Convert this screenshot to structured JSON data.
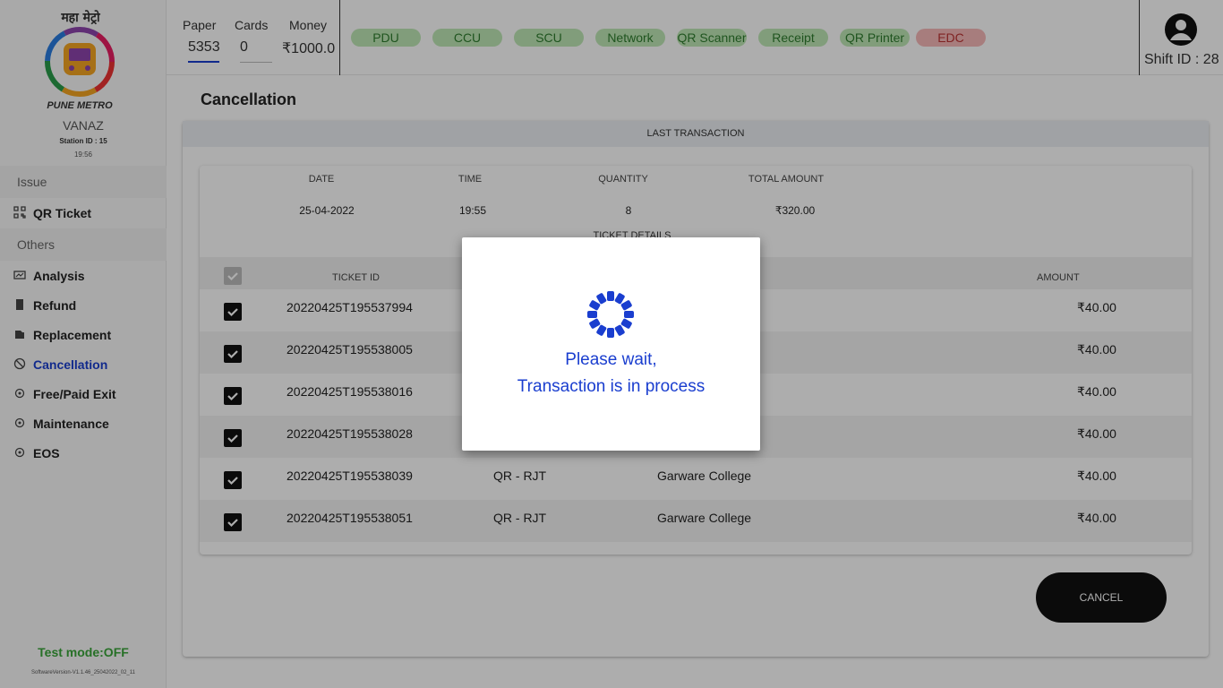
{
  "sidebar": {
    "logo_text_top": "महा मेट्रो",
    "logo_text_bottom": "PUNE METRO",
    "station_name": "VANAZ",
    "station_id": "Station ID : 15",
    "time": "19:56",
    "issue_label": "Issue",
    "others_label": "Others",
    "items": [
      {
        "label": "QR Ticket",
        "icon": "qr-icon"
      },
      {
        "label": "Analysis",
        "icon": "chart-icon"
      },
      {
        "label": "Refund",
        "icon": "refund-icon"
      },
      {
        "label": "Replacement",
        "icon": "replace-icon"
      },
      {
        "label": "Cancellation",
        "icon": "cancel-icon"
      },
      {
        "label": "Free/Paid Exit",
        "icon": "exit-icon"
      },
      {
        "label": "Maintenance",
        "icon": "gear-icon"
      },
      {
        "label": "EOS",
        "icon": "gear-icon"
      }
    ],
    "test_mode": "Test mode:OFF",
    "software_version": "SoftwareVersion-V1.1.46_25042022_02_11"
  },
  "topbar": {
    "paper_label": "Paper",
    "paper_value": "5353",
    "cards_label": "Cards",
    "cards_value": "0",
    "money_label": "Money",
    "money_value": "₹1000.0",
    "statuses": [
      {
        "label": "PDU",
        "state": "ok"
      },
      {
        "label": "CCU",
        "state": "ok"
      },
      {
        "label": "SCU",
        "state": "ok"
      },
      {
        "label": "Network",
        "state": "ok"
      },
      {
        "label": "QR Scanner",
        "state": "ok"
      },
      {
        "label": "Receipt",
        "state": "ok"
      },
      {
        "label": "QR Printer",
        "state": "ok"
      },
      {
        "label": "EDC",
        "state": "error"
      }
    ],
    "shift": "Shift ID : 28"
  },
  "main": {
    "title": "Cancellation",
    "last_transaction_label": "LAST TRANSACTION",
    "summary_headers": [
      "DATE",
      "TIME",
      "QUANTITY",
      "TOTAL AMOUNT"
    ],
    "summary_values": [
      "25-04-2022",
      "19:55",
      "8",
      "₹320.00"
    ],
    "ticket_details_label": "TICKET DETAILS",
    "ticket_headers": {
      "ticket_id": "TICKET ID",
      "amount": "AMOUNT"
    },
    "tickets": [
      {
        "id": "20220425T195537994",
        "type": "",
        "destination": "",
        "amount": "₹40.00"
      },
      {
        "id": "20220425T195538005",
        "type": "",
        "destination": "",
        "amount": "₹40.00"
      },
      {
        "id": "20220425T195538016",
        "type": "",
        "destination": "",
        "amount": "₹40.00"
      },
      {
        "id": "20220425T195538028",
        "type": "",
        "destination": "",
        "amount": "₹40.00"
      },
      {
        "id": "20220425T195538039",
        "type": "QR - RJT",
        "destination": "Garware College",
        "amount": "₹40.00"
      },
      {
        "id": "20220425T195538051",
        "type": "QR - RJT",
        "destination": "Garware College",
        "amount": "₹40.00"
      }
    ],
    "cancel_label": "CANCEL"
  },
  "dialog": {
    "line1": "Please wait,",
    "line2": "Transaction is in process"
  },
  "colors": {
    "accent": "#1a3ecf",
    "ok_pill": "#bfe8b5",
    "error_pill": "#f7b8b8",
    "test_mode": "#3aa63a"
  }
}
